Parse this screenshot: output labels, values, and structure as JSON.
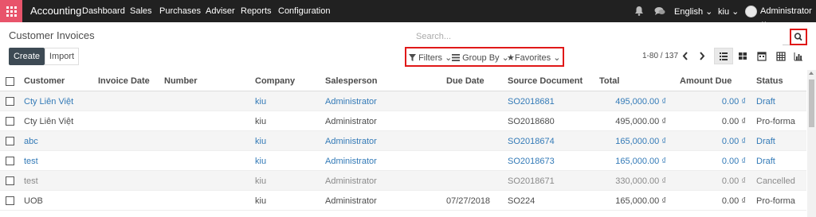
{
  "topbar": {
    "brand": "Accounting",
    "menu": [
      "Dashboard",
      "Sales",
      "Purchases",
      "Adviser",
      "Reports",
      "Configuration"
    ],
    "language": "English",
    "user_short": "kiu",
    "user": "Administrator"
  },
  "control": {
    "title": "Customer Invoices",
    "create": "Create",
    "import": "Import",
    "search_placeholder": "Search...",
    "filters": "Filters",
    "group_by": "Group By",
    "favorites": "Favorites",
    "pager": "1-80 / 137"
  },
  "table": {
    "headers": [
      "Customer",
      "Invoice Date",
      "Number",
      "Company",
      "Salesperson",
      "Due Date",
      "Source Document",
      "Total",
      "Amount Due",
      "Status"
    ],
    "rows": [
      {
        "customer": "Cty Liên Việt",
        "invoice_date": "",
        "number": "",
        "company": "kiu",
        "salesperson": "Administrator",
        "due_date": "",
        "source": "SO2018681",
        "total": "495,000.00 ₫",
        "amount_due": "0.00 ₫",
        "status": "Draft"
      },
      {
        "customer": "Cty Liên Việt",
        "invoice_date": "",
        "number": "",
        "company": "kiu",
        "salesperson": "Administrator",
        "due_date": "",
        "source": "SO2018680",
        "total": "495,000.00 ₫",
        "amount_due": "0.00 ₫",
        "status": "Pro-forma"
      },
      {
        "customer": "abc",
        "invoice_date": "",
        "number": "",
        "company": "kiu",
        "salesperson": "Administrator",
        "due_date": "",
        "source": "SO2018674",
        "total": "165,000.00 ₫",
        "amount_due": "0.00 ₫",
        "status": "Draft"
      },
      {
        "customer": "test",
        "invoice_date": "",
        "number": "",
        "company": "kiu",
        "salesperson": "Administrator",
        "due_date": "",
        "source": "SO2018673",
        "total": "165,000.00 ₫",
        "amount_due": "0.00 ₫",
        "status": "Draft"
      },
      {
        "customer": "test",
        "invoice_date": "",
        "number": "",
        "company": "kiu",
        "salesperson": "Administrator",
        "due_date": "",
        "source": "SO2018671",
        "total": "330,000.00 ₫",
        "amount_due": "0.00 ₫",
        "status": "Cancelled"
      },
      {
        "customer": "UOB",
        "invoice_date": "",
        "number": "",
        "company": "kiu",
        "salesperson": "Administrator",
        "due_date": "07/27/2018",
        "source": "SO224",
        "total": "165,000.00 ₫",
        "amount_due": "0.00 ₫",
        "status": "Pro-forma"
      }
    ]
  },
  "colors": {
    "nav_bg": "#212121",
    "apps_accent": "#e8546b",
    "link": "#337ab7",
    "highlight_box": "#e01818",
    "create_btn": "#3d4a54"
  }
}
